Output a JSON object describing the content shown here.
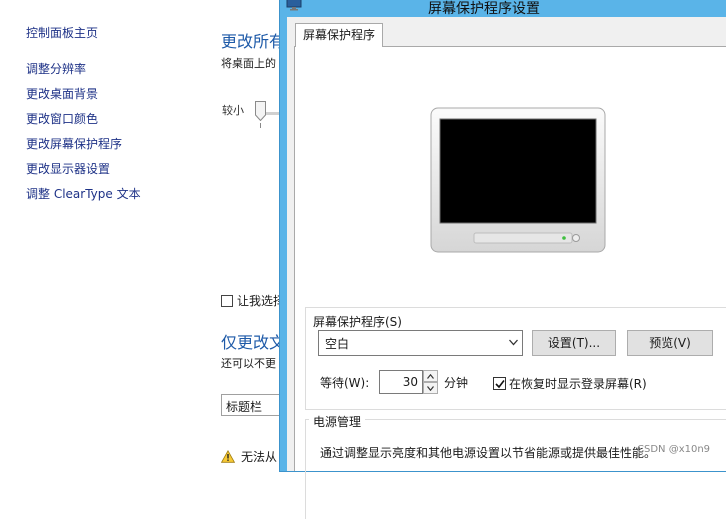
{
  "control_panel": {
    "home": "控制面板主页",
    "nav": [
      "调整分辨率",
      "更改桌面背景",
      "更改窗口颜色",
      "更改屏幕保护程序",
      "更改显示器设置",
      "调整 ClearType 文本"
    ],
    "heading": "更改所有",
    "subtext": "将桌面上的",
    "slider_min_label": "较小",
    "checkbox_label": "让我选择",
    "heading2": "仅更改文",
    "subtext2": "还可以不更",
    "select_value": "标题栏",
    "warning_text": "无法从"
  },
  "dialog": {
    "title": "屏幕保护程序设置",
    "tab_label": "屏幕保护程序",
    "screensaver_group_label": "屏幕保护程序(S)",
    "screensaver_value": "空白",
    "settings_button": "设置(T)...",
    "preview_button": "预览(V)",
    "wait_label": "等待(W):",
    "wait_value": "30",
    "minutes_label": "分钟",
    "logon_checkbox_label": "在恢复时显示登录屏幕(R)",
    "logon_checked": true,
    "power_group_label": "电源管理",
    "power_text": "通过调整显示亮度和其他电源设置以节省能源或提供最佳性能。"
  },
  "watermark": "CSDN @x10n9",
  "colors": {
    "title_bar": "#5ab4e8",
    "link": "#1e3287",
    "heading": "#1e5aa8"
  }
}
